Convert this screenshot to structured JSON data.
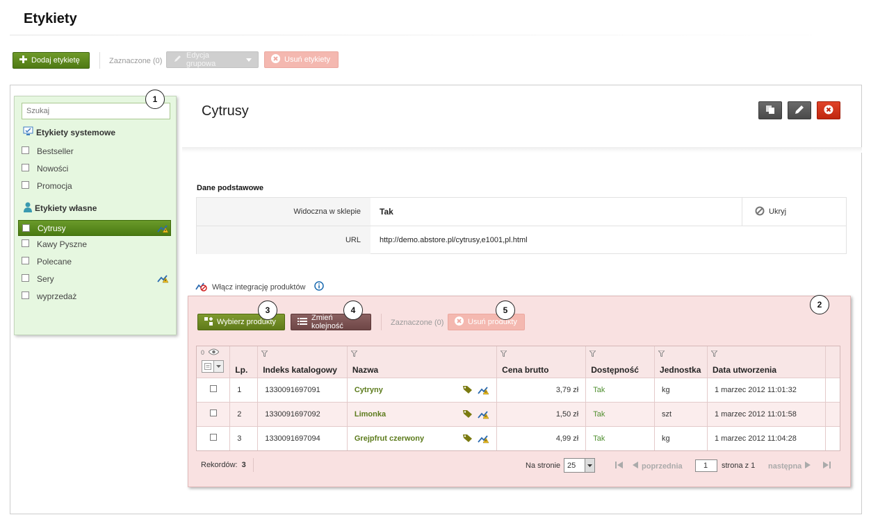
{
  "page": {
    "title": "Etykiety"
  },
  "toolbar": {
    "add_label": "Dodaj etykietę",
    "selected": "Zaznaczone (0)",
    "group_edit": "Edycja grupowa",
    "delete": "Usuń etykiety"
  },
  "sidebar": {
    "search_placeholder": "Szukaj",
    "system_header": "Etykiety systemowe",
    "system_items": [
      "Bestseller",
      "Nowości",
      "Promocja"
    ],
    "own_header": "Etykiety własne",
    "own_items": [
      "Cytrusy",
      "Kawy Pyszne",
      "Polecane",
      "Sery",
      "wyprzedaż"
    ]
  },
  "callouts": [
    "1",
    "2",
    "3",
    "4",
    "5"
  ],
  "detail": {
    "title": "Cytrusy",
    "section": "Dane podstawowe",
    "visible_key": "Widoczna w sklepie",
    "visible_val": "Tak",
    "hide_action": "Ukryj",
    "url_key": "URL",
    "url_val": "http://demo.abstore.pl/cytrusy,e1001,pl.html"
  },
  "integration": "Włącz integrację produktów",
  "products": {
    "choose": "Wybierz produkty",
    "reorder": "Zmień kolejność",
    "selected": "Zaznaczone (0)",
    "delete": "Usuń produkty",
    "visible_count": "0",
    "columns": [
      "Lp.",
      "Indeks katalogowy",
      "Nazwa",
      "Cena brutto",
      "Dostępność",
      "Jednostka",
      "Data utworzenia"
    ],
    "rows": [
      {
        "lp": "1",
        "index": "1330091697091",
        "name": "Cytryny",
        "price": "3,79 zł",
        "avail": "Tak",
        "unit": "kg",
        "created": "1 marzec 2012 11:01:32"
      },
      {
        "lp": "2",
        "index": "1330091697092",
        "name": "Limonka",
        "price": "1,50 zł",
        "avail": "Tak",
        "unit": "szt",
        "created": "1 marzec 2012 11:01:58"
      },
      {
        "lp": "3",
        "index": "1330091697094",
        "name": "Grejpfrut czerwony",
        "price": "4,99 zł",
        "avail": "Tak",
        "unit": "kg",
        "created": "1 marzec 2012 11:04:28"
      }
    ],
    "records_label": "Rekordów:",
    "records_count": "3",
    "per_page_label": "Na stronie",
    "per_page": "25",
    "prev": "poprzednia",
    "page": "1",
    "page_of": "strona z 1",
    "next": "następna"
  },
  "colors": {
    "accent_green": "#4f7a14",
    "panel_green": "#e6f7e0",
    "panel_pink": "#f9e1e1",
    "danger_red": "#c0260e"
  }
}
